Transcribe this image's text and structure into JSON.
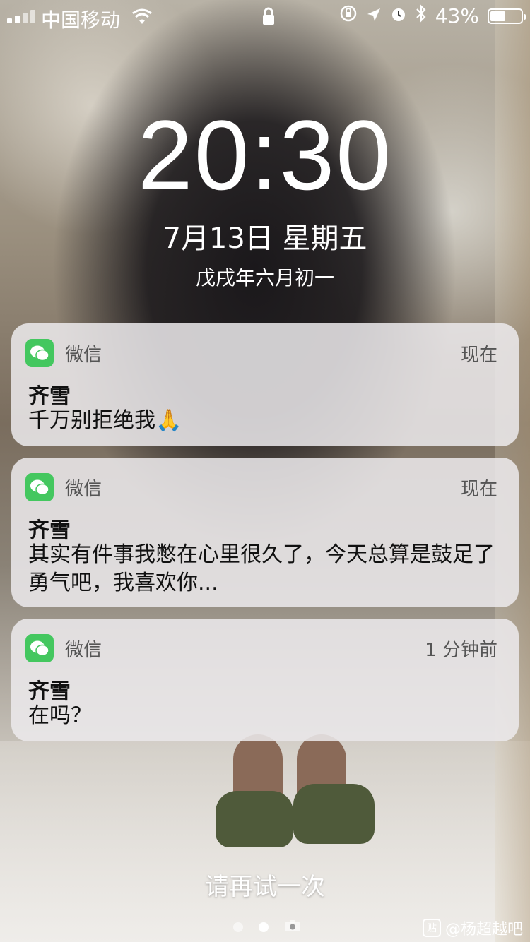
{
  "status_bar": {
    "carrier": "中国移动",
    "battery_percent": "43%",
    "battery_level": 0.43,
    "icons": [
      "signal-icon",
      "wifi-icon",
      "lock-icon",
      "orientation-lock-icon",
      "location-icon",
      "alarm-icon",
      "bluetooth-icon",
      "battery-icon"
    ]
  },
  "lock_screen": {
    "time": "20:30",
    "date": "7月13日 星期五",
    "lunar_date": "戊戌年六月初一",
    "retry_text": "请再试一次"
  },
  "notifications": [
    {
      "app": "微信",
      "time": "现在",
      "sender": "齐雪",
      "message": "千万别拒绝我🙏"
    },
    {
      "app": "微信",
      "time": "现在",
      "sender": "齐雪",
      "message": "其实有件事我憋在心里很久了，今天总算是鼓足了勇气吧，我喜欢你..."
    },
    {
      "app": "微信",
      "time": "1 分钟前",
      "sender": "齐雪",
      "message": "在吗？"
    }
  ],
  "watermark": {
    "badge": "贴",
    "text": "@杨超越吧"
  },
  "colors": {
    "wechat_green": "#44c75f",
    "notification_bg": "#ecEAEC"
  }
}
